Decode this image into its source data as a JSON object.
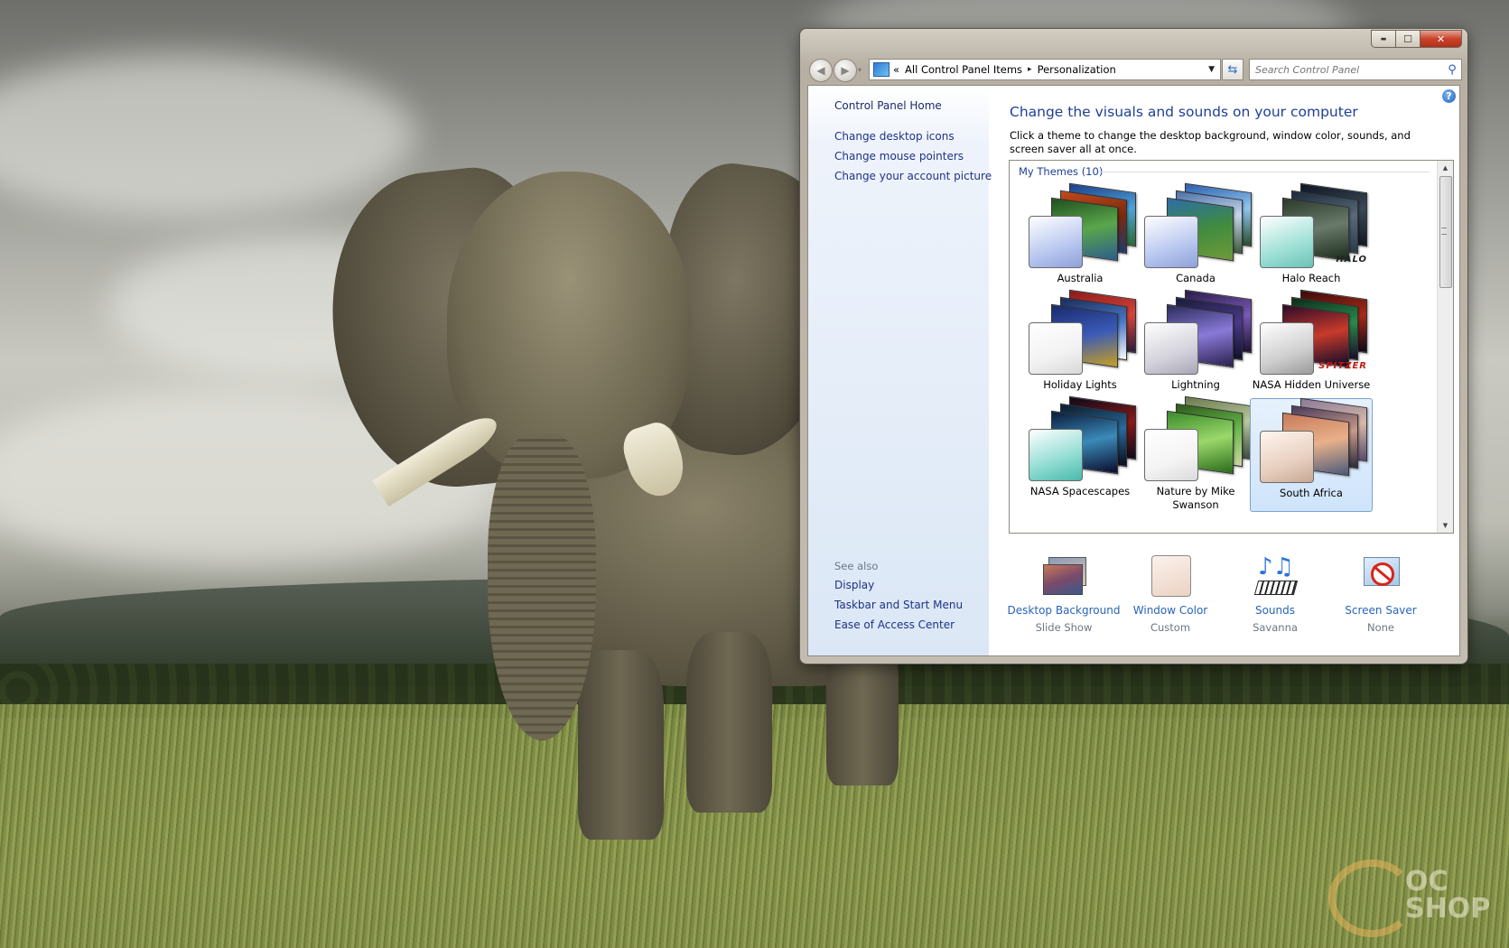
{
  "window": {
    "caption_buttons": {
      "minimize": "▬",
      "maximize": "☐",
      "close": "✕"
    },
    "navigation": {
      "back_glyph": "◀",
      "forward_glyph": "▶",
      "history_glyph": "▾"
    },
    "address_bar": {
      "overflow": "«",
      "segments": [
        "All Control Panel Items",
        "Personalization"
      ],
      "separator": "▸",
      "dropdown_glyph": "▼",
      "refresh_glyph": "⇆"
    },
    "search": {
      "placeholder": "Search Control Panel",
      "icon": "search-icon"
    }
  },
  "left_pane": {
    "home": "Control Panel Home",
    "tasks": [
      "Change desktop icons",
      "Change mouse pointers",
      "Change your account picture"
    ],
    "see_also_heading": "See also",
    "see_also": [
      "Display",
      "Taskbar and Start Menu",
      "Ease of Access Center"
    ]
  },
  "main": {
    "help_glyph": "?",
    "title": "Change the visuals and sounds on your computer",
    "description": "Click a theme to change the desktop background, window color, sounds, and screen saver all at once.",
    "group_label": "My Themes (10)",
    "themes": [
      {
        "label": "Australia",
        "selected": false,
        "window_color": "#b9c8f0",
        "brand": ""
      },
      {
        "label": "Canada",
        "selected": false,
        "window_color": "#b9c8f0",
        "brand": ""
      },
      {
        "label": "Halo Reach",
        "selected": false,
        "window_color": "#9ee0d6",
        "brand": "HALO"
      },
      {
        "label": "Holiday Lights",
        "selected": false,
        "window_color": "#f2f2f2",
        "brand": ""
      },
      {
        "label": "Lightning",
        "selected": false,
        "window_color": "#d4d2dc",
        "brand": ""
      },
      {
        "label": "NASA Hidden Universe",
        "selected": false,
        "window_color": "#cfcfcf",
        "brand": "SPITZER"
      },
      {
        "label": "NASA Spacescapes",
        "selected": false,
        "window_color": "#8fdcd2",
        "brand": ""
      },
      {
        "label": "Nature by Mike Swanson",
        "selected": false,
        "window_color": "#f4f4f4",
        "brand": ""
      },
      {
        "label": "South Africa",
        "selected": true,
        "window_color": "#e8cfc0",
        "brand": ""
      }
    ],
    "bottom_bar": [
      {
        "label": "Desktop Background",
        "value": "Slide Show",
        "icon": "desktop-background-icon"
      },
      {
        "label": "Window Color",
        "value": "Custom",
        "icon": "window-color-icon"
      },
      {
        "label": "Sounds",
        "value": "Savanna",
        "icon": "sounds-icon"
      },
      {
        "label": "Screen Saver",
        "value": "None",
        "icon": "screen-saver-icon"
      }
    ]
  },
  "colors": {
    "link": "#1e3287",
    "title": "#1e3f96",
    "selection_fill": "#cfe4fb",
    "close_button": "#c8432b"
  }
}
